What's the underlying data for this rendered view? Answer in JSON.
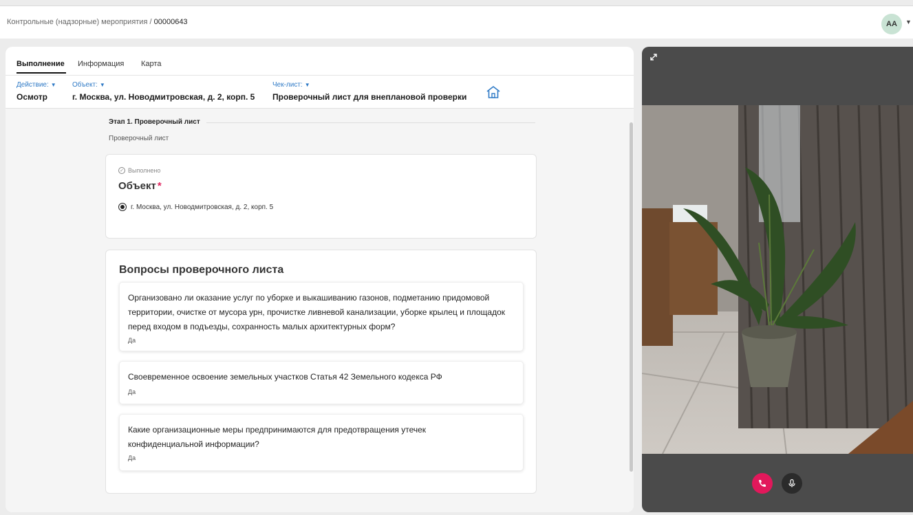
{
  "header": {
    "breadcrumb_parent": "Контрольные (надзорные) мероприятия",
    "breadcrumb_separator": "/",
    "breadcrumb_current": "00000643",
    "avatar_initials": "AA"
  },
  "tabs": [
    {
      "label": "Выполнение",
      "active": true
    },
    {
      "label": "Информация",
      "active": false
    },
    {
      "label": "Карта",
      "active": false
    }
  ],
  "filters": {
    "action": {
      "label": "Действие:",
      "value": "Осмотр"
    },
    "object": {
      "label": "Объект:",
      "value": "г. Москва, ул. Новодмитровская, д. 2, корп. 5"
    },
    "checklist": {
      "label": "Чек-лист:",
      "value": "Проверочный лист для внеплановой проверки"
    }
  },
  "stage": {
    "title": "Этап 1. Проверочный лист",
    "subtitle": "Проверочный лист"
  },
  "object_card": {
    "status": "Выполнено",
    "title": "Объект",
    "required_mark": "*",
    "option": "г. Москва, ул. Новодмитровская, д. 2, корп. 5"
  },
  "questions_card": {
    "heading": "Вопросы проверочного листа",
    "questions": [
      {
        "text": "Организовано ли оказание услуг по уборке и выкашиванию газонов, подметанию придомовой территории, очистке от мусора урн, прочистке ливневой канализации, уборке крылец и площадок перед входом в подъезды, сохранность малых архитектурных форм?",
        "answer": "Да"
      },
      {
        "text": "Своевременное освоение земельных участков Статья 42 Земельного кодекса РФ",
        "answer": "Да"
      },
      {
        "text": "Какие организационные меры предпринимаются для предотвращения утечек конфиденциальной информации?",
        "answer": "Да"
      }
    ]
  },
  "video": {
    "icons": [
      "expand-icon",
      "phone-icon",
      "microphone-icon"
    ],
    "colors": {
      "end_call": "#e2185b",
      "panel": "#4b4b4b"
    }
  },
  "colors": {
    "accent_link": "#2f7ac6",
    "required": "#e0245e"
  }
}
